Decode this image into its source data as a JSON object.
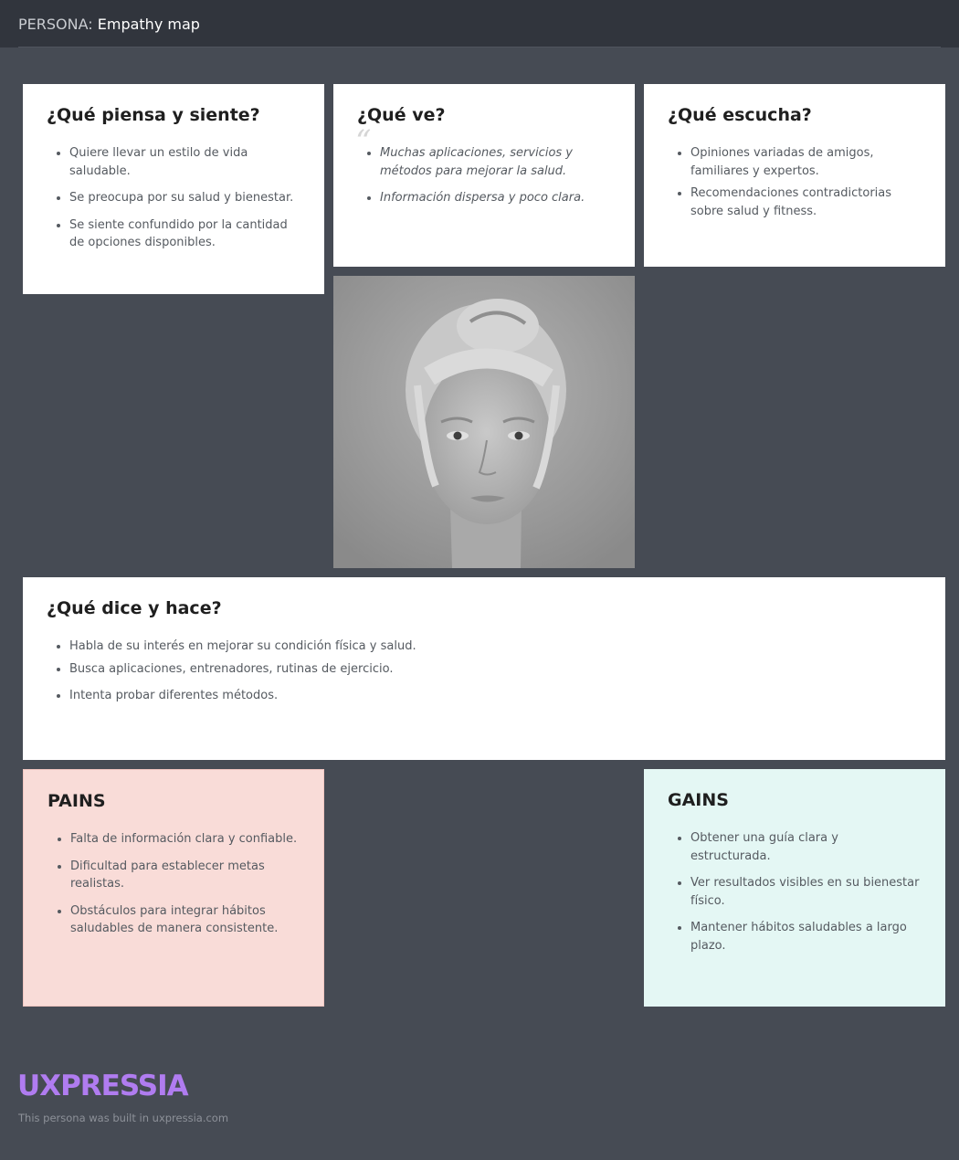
{
  "header": {
    "prefix": "PERSONA:",
    "title": "Empathy map"
  },
  "think_feel": {
    "title": "¿Qué piensa y siente?",
    "items": [
      "Quiere llevar un estilo de vida saludable.",
      "Se preocupa por su salud y bienestar.",
      "Se siente confundido por la cantidad de opciones disponibles."
    ]
  },
  "see": {
    "title": "¿Qué ve?",
    "items": [
      "Muchas aplicaciones, servicios y métodos para mejorar la salud.",
      "Información dispersa y poco clara."
    ]
  },
  "hear": {
    "title": "¿Qué escucha?",
    "items": [
      "Opiniones variadas de amigos, familiares y expertos.",
      "Recomendaciones contradictorias sobre salud y fitness."
    ]
  },
  "say_do": {
    "title": "¿Qué dice y hace?",
    "items": [
      "Habla de su interés en mejorar su condición física y salud.",
      "Busca aplicaciones, entrenadores, rutinas de ejercicio.",
      "Intenta probar diferentes métodos."
    ]
  },
  "pains": {
    "title": "PAINS",
    "items": [
      "Falta de información clara y confiable.",
      "Dificultad para establecer metas realistas.",
      "Obstáculos para integrar hábitos saludables de manera consistente."
    ]
  },
  "gains": {
    "title": "GAINS",
    "items": [
      "Obtener una guía clara y estructurada.",
      "Ver resultados visibles en su bienestar físico.",
      "Mantener hábitos saludables a largo plazo."
    ]
  },
  "footer": {
    "logo": "UXPRESSIA",
    "note": "This persona was built in uxpressia.com"
  },
  "colors": {
    "background": "#464b54",
    "header": "#31353d",
    "pains": "#f9dcd8",
    "gains": "#e4f7f4",
    "brand": "#b07cf0"
  }
}
